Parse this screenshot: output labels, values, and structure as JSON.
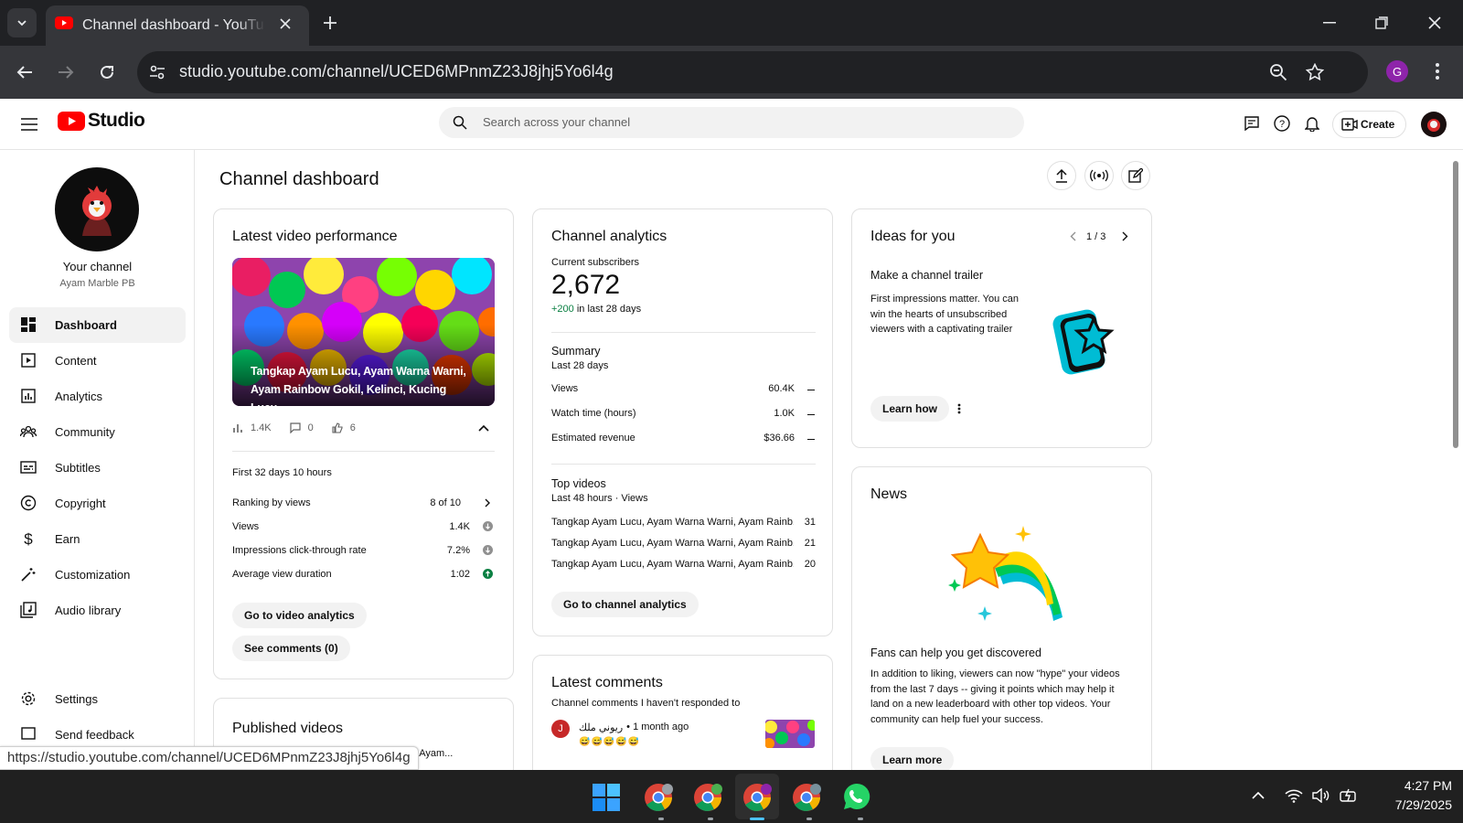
{
  "browser": {
    "tab_title": "Channel dashboard - YouTube Studio",
    "url": "studio.youtube.com/channel/UCED6MPnmZ23J8jhj5Yo6l4g",
    "profile_initial": "G",
    "status_url": "https://studio.youtube.com/channel/UCED6MPnmZ23J8jhj5Yo6l4g"
  },
  "header": {
    "logo_text": "Studio",
    "search_placeholder": "Search across your channel",
    "create_label": "Create"
  },
  "sidebar": {
    "channel_title": "Your channel",
    "channel_name": "Ayam Marble PB",
    "items": [
      {
        "label": "Dashboard",
        "icon": "dashboard-icon"
      },
      {
        "label": "Content",
        "icon": "content-icon"
      },
      {
        "label": "Analytics",
        "icon": "analytics-icon"
      },
      {
        "label": "Community",
        "icon": "community-icon"
      },
      {
        "label": "Subtitles",
        "icon": "subtitles-icon"
      },
      {
        "label": "Copyright",
        "icon": "copyright-icon"
      },
      {
        "label": "Earn",
        "icon": "dollar-icon"
      },
      {
        "label": "Customization",
        "icon": "magic-wand-icon"
      },
      {
        "label": "Audio library",
        "icon": "audio-library-icon"
      }
    ],
    "settings_label": "Settings",
    "feedback_label": "Send feedback"
  },
  "page": {
    "title": "Channel dashboard"
  },
  "latest_video": {
    "title": "Latest video performance",
    "video_caption": "Tangkap Ayam Lucu, Ayam Warna Warni, Ayam Rainbow Gokil, Kelinci, Kucing Lucu,...",
    "views": "1.4K",
    "comments": "0",
    "likes": "6",
    "period": "First 32 days 10 hours",
    "stats": [
      {
        "label": "Ranking by views",
        "value": "8 of 10"
      },
      {
        "label": "Views",
        "value": "1.4K"
      },
      {
        "label": "Impressions click-through rate",
        "value": "7.2%"
      },
      {
        "label": "Average view duration",
        "value": "1:02"
      }
    ],
    "analytics_button": "Go to video analytics",
    "comments_button": "See comments (0)"
  },
  "published": {
    "title": "Published videos",
    "first_item": "Tangkap Ayam Lucu, Ayam Warna Warni, Ayam..."
  },
  "channel_analytics": {
    "title": "Channel analytics",
    "subs_label": "Current subscribers",
    "subs_value": "2,672",
    "subs_delta": "+200",
    "subs_delta_suffix": "in last 28 days",
    "summary_title": "Summary",
    "summary_period": "Last 28 days",
    "summary": [
      {
        "label": "Views",
        "value": "60.4K"
      },
      {
        "label": "Watch time (hours)",
        "value": "1.0K"
      },
      {
        "label": "Estimated revenue",
        "value": "$36.66"
      }
    ],
    "top_title": "Top videos",
    "top_period": "Last 48 hours · Views",
    "top": [
      {
        "title": "Tangkap Ayam Lucu, Ayam Warna Warni, Ayam Rainb...",
        "views": "31"
      },
      {
        "title": "Tangkap Ayam Lucu, Ayam Warna Warni, Ayam Rainb...",
        "views": "21"
      },
      {
        "title": "Tangkap Ayam Lucu, Ayam Warna Warni, Ayam Rainb...",
        "views": "20"
      }
    ],
    "button": "Go to channel analytics"
  },
  "comments": {
    "title": "Latest comments",
    "subtitle": "Channel comments I haven't responded to",
    "author": "ريوني ملك",
    "time": "• 1 month ago",
    "avatar_initial": "J",
    "text": "😅😅😅😅😅"
  },
  "ideas": {
    "title": "Ideas for you",
    "pager": "1 / 3",
    "item_title": "Make a channel trailer",
    "item_text": "First impressions matter. You can win the hearts of unsubscribed viewers with a captivating trailer",
    "button": "Learn how"
  },
  "news": {
    "title": "News",
    "item_title": "Fans can help you get discovered",
    "item_text": "In addition to liking, viewers can now \"hype\" your videos from the last 7 days -- giving it points which may help it land on a new leaderboard with other top videos. Your community can help fuel your success.",
    "button": "Learn more"
  },
  "taskbar": {
    "time": "4:27 PM",
    "date": "7/29/2025"
  },
  "colors": {
    "brand_red": "#ff0000",
    "positive": "#0b8043",
    "profile": "#8e24aa"
  }
}
